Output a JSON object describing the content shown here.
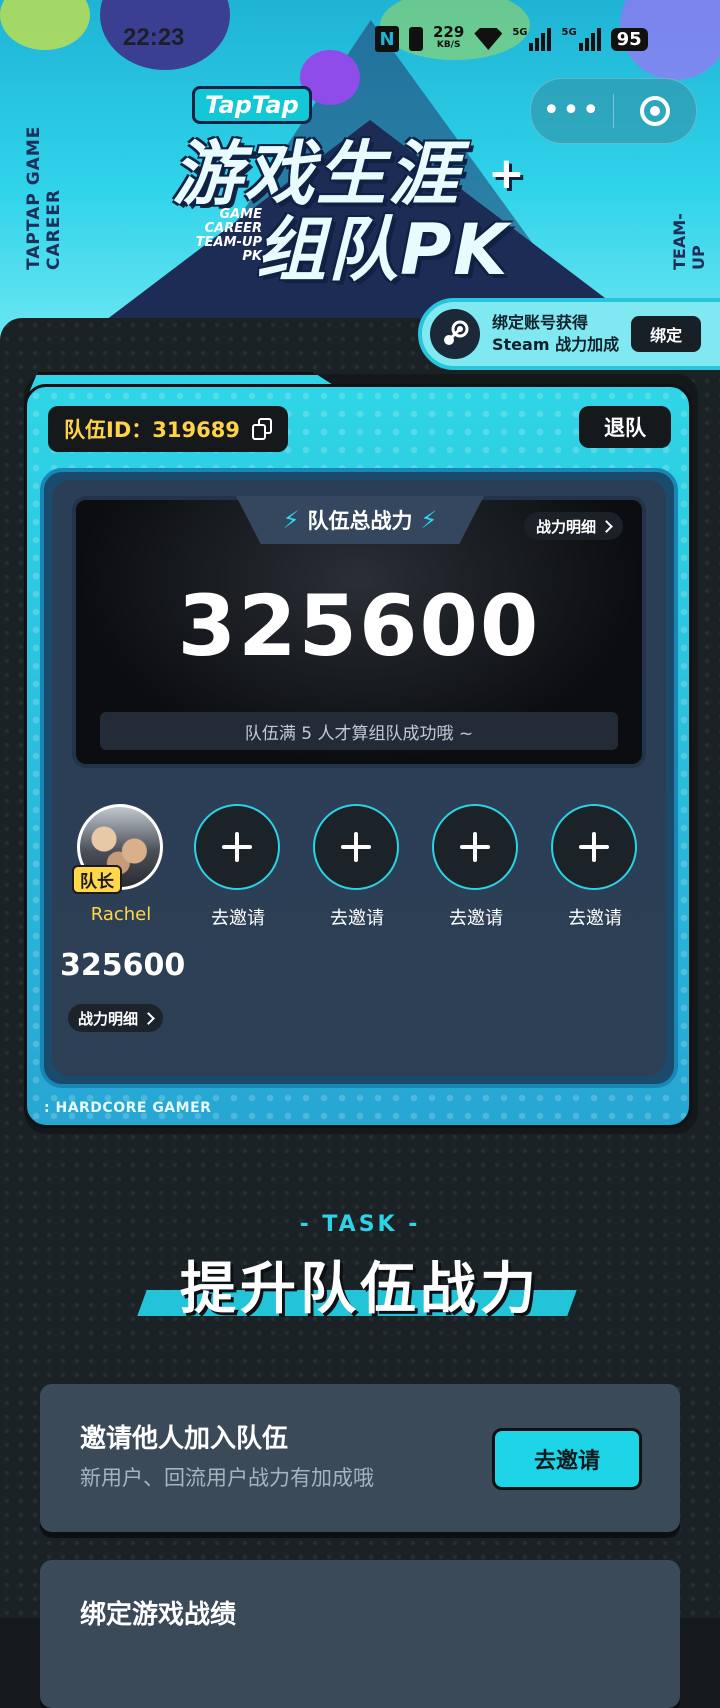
{
  "status_bar": {
    "time": "22:23",
    "net_speed": "229",
    "net_unit": "KB/S",
    "signal1_label": "5G",
    "signal2_label": "5G",
    "battery": "95"
  },
  "header": {
    "logo": "TapTap",
    "title_line1": "游戏生涯",
    "title_line2": "组队PK",
    "title_en": "GAME CAREER TEAM-UP PK",
    "side_left": "TAPTAP GAME CAREER",
    "side_right": "TEAM-UP"
  },
  "steam_bind": {
    "line1": "绑定账号获得",
    "line2": "Steam 战力加成",
    "button": "绑定"
  },
  "team": {
    "id_label": "队伍ID：319689",
    "quit_button": "退队",
    "total_power_label": "队伍总战力",
    "power_detail_button": "战力明细",
    "total_power": "325600",
    "hint": "队伍满 5 人才算组队成功哦 ~",
    "captain_badge": "队长",
    "members": [
      {
        "name": "Rachel",
        "is_captain": true
      },
      {
        "name": "去邀请",
        "is_captain": false
      },
      {
        "name": "去邀请",
        "is_captain": false
      },
      {
        "name": "去邀请",
        "is_captain": false
      },
      {
        "name": "去邀请",
        "is_captain": false
      }
    ],
    "member_power": "325600",
    "member_detail_button": "战力明细",
    "footer_tag": ": HARDCORE GAMER"
  },
  "task": {
    "subtitle": "- TASK -",
    "title": "提升队伍战力",
    "items": [
      {
        "title": "邀请他人加入队伍",
        "desc": "新用户、回流用户战力有加成哦",
        "button": "去邀请"
      },
      {
        "title": "绑定游戏战绩",
        "desc": "",
        "button": ""
      }
    ]
  },
  "colors": {
    "accent": "#1ed5e8",
    "gold": "#ffd84a",
    "background": "#1b2226"
  }
}
